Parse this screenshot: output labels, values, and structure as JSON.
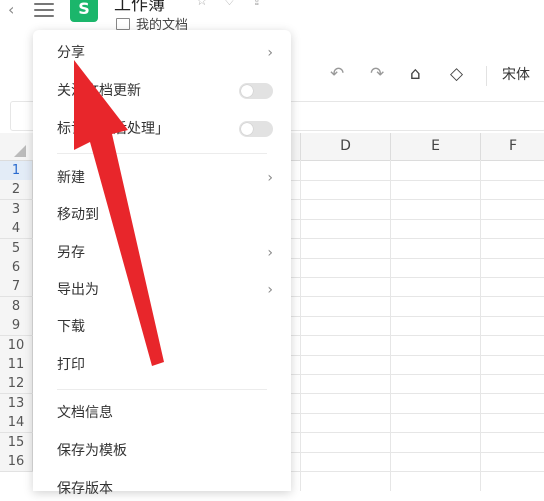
{
  "header": {
    "doc_title": "工作簿",
    "folder": "我的文档",
    "logo_text": "S"
  },
  "toolbar": {
    "font_name": "宋体"
  },
  "columns": [
    "D",
    "E",
    "F"
  ],
  "rows": [
    "1",
    "2",
    "3",
    "4",
    "5",
    "6",
    "7",
    "8",
    "9",
    "10",
    "11",
    "12",
    "13",
    "14",
    "15",
    "16"
  ],
  "menu": {
    "items": [
      {
        "label": "分享",
        "has_submenu": true
      },
      {
        "label": "关注文档更新",
        "toggle": false
      },
      {
        "label": "标记「稍后处理」",
        "toggle": false
      },
      {
        "label": "新建",
        "has_submenu": true
      },
      {
        "label": "移动到"
      },
      {
        "label": "另存",
        "has_submenu": true
      },
      {
        "label": "导出为",
        "has_submenu": true
      },
      {
        "label": "下载"
      },
      {
        "label": "打印"
      },
      {
        "label": "文档信息"
      },
      {
        "label": "保存为模板"
      },
      {
        "label": "保存版本"
      }
    ]
  },
  "colors": {
    "accent_green": "#1bb66b",
    "arrow_red": "#e8262b"
  }
}
